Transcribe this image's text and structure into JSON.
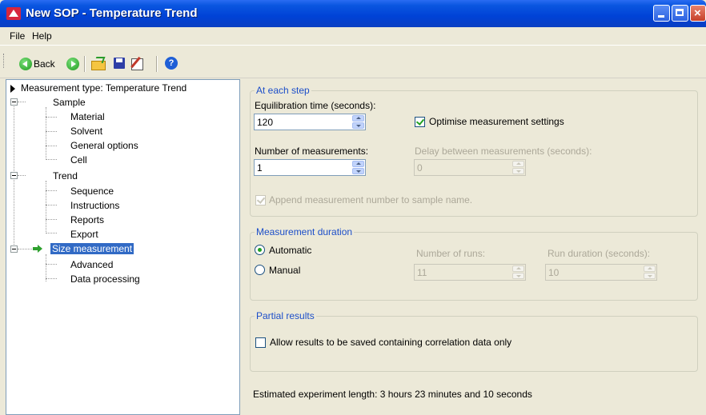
{
  "window": {
    "title": "New SOP - Temperature Trend"
  },
  "menu": {
    "file": "File",
    "help": "Help"
  },
  "toolbar": {
    "back_label": "Back"
  },
  "tree": {
    "root": "Measurement type: Temperature Trend",
    "sample": "Sample",
    "sample_children": [
      "Material",
      "Solvent",
      "General options",
      "Cell"
    ],
    "trend": "Trend",
    "trend_children": [
      "Sequence",
      "Instructions",
      "Reports",
      "Export"
    ],
    "size": "Size measurement",
    "size_children": [
      "Advanced",
      "Data processing"
    ]
  },
  "at_each_step": {
    "legend": "At each step",
    "equilibration_label": "Equilibration time (seconds):",
    "equilibration_value": "120",
    "optimise_label": "Optimise measurement settings",
    "optimise_checked": true,
    "num_measurements_label": "Number of measurements:",
    "num_measurements_value": "1",
    "delay_label": "Delay between measurements (seconds):",
    "delay_value": "0",
    "append_label": "Append measurement number to sample name.",
    "append_checked": true
  },
  "duration": {
    "legend": "Measurement duration",
    "automatic_label": "Automatic",
    "manual_label": "Manual",
    "selected": "Automatic",
    "runs_label": "Number of runs:",
    "runs_value": "11",
    "run_duration_label": "Run duration (seconds):",
    "run_duration_value": "10"
  },
  "partial": {
    "legend": "Partial results",
    "allow_label": "Allow results to be saved containing correlation data only",
    "allow_checked": false
  },
  "estimate": {
    "text": "Estimated experiment length: 3 hours 23 minutes and 10 seconds"
  },
  "colors": {
    "selection": "#316ac5",
    "legend_text": "#1c4ec9",
    "title_bar": "#0042d6"
  }
}
